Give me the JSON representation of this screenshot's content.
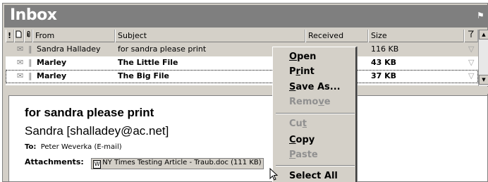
{
  "inbox": {
    "title": "Inbox"
  },
  "columns": {
    "importance": "!",
    "icon": "🗋",
    "attachment": "∥",
    "from": "From",
    "subject": "Subject",
    "received": "Received",
    "size": "Size",
    "flag": "▽"
  },
  "messages": [
    {
      "from": "Sandra Halladey",
      "subject": "for sandra please print",
      "received": "",
      "size": "116 KB",
      "bold": false,
      "selected": true
    },
    {
      "from": "Marley",
      "subject": "The Little File",
      "received": "",
      "size": "43 KB",
      "bold": true,
      "selected": false
    },
    {
      "from": "Marley",
      "subject": "The Big File",
      "received": "",
      "size": "37 KB",
      "bold": true,
      "selected": false
    }
  ],
  "preview": {
    "subject": "for sandra please print",
    "from": "Sandra [shalladey@ac.net]",
    "to_label": "To:",
    "to_value": "Peter Weverka (E-mail)",
    "attachments_label": "Attachments:",
    "attachment_file": "NY Times Testing Article - Traub.doc (111 KB)"
  },
  "context_menu": {
    "items": [
      {
        "label": "Open",
        "underline": "O",
        "enabled": true
      },
      {
        "label": "Print",
        "underline": "r",
        "enabled": true
      },
      {
        "label": "Save As...",
        "underline": "S",
        "enabled": true
      },
      {
        "label": "Remove",
        "underline": "v",
        "enabled": false
      },
      {
        "label": "Cut",
        "underline": "t",
        "enabled": false
      },
      {
        "label": "Copy",
        "underline": "C",
        "enabled": true
      },
      {
        "label": "Paste",
        "underline": "P",
        "enabled": false
      },
      {
        "label": "Select All",
        "underline": "",
        "enabled": true
      }
    ]
  }
}
